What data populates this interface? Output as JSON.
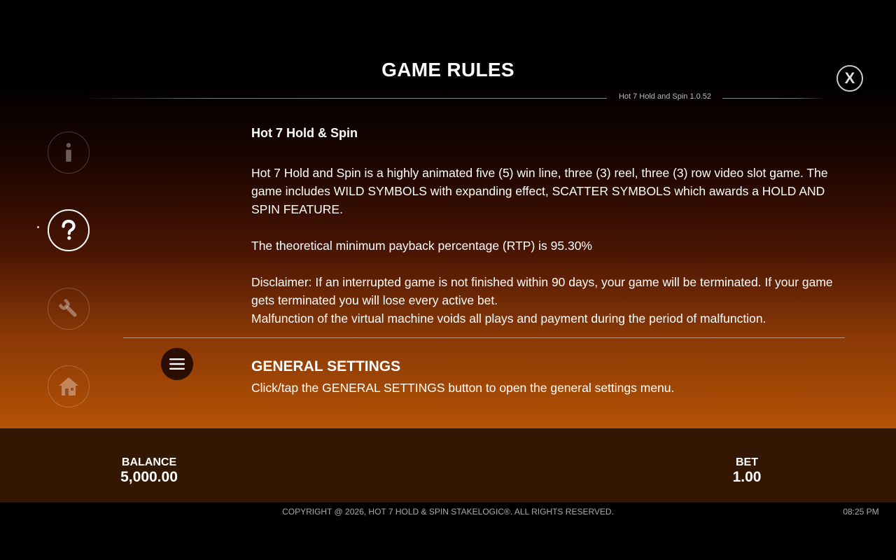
{
  "header": {
    "title": "GAME RULES",
    "version": "Hot 7 Hold and Spin 1.0.52",
    "close_label": "X"
  },
  "sidebar": {
    "items": [
      {
        "name": "info",
        "icon": "info-icon",
        "active": false
      },
      {
        "name": "rules",
        "icon": "question-icon",
        "active": true
      },
      {
        "name": "settings",
        "icon": "wrench-icon",
        "active": false
      },
      {
        "name": "home",
        "icon": "home-icon",
        "active": false
      }
    ]
  },
  "rules": {
    "game_title": "Hot 7 Hold & Spin",
    "description": "Hot 7 Hold and Spin is a highly animated five (5) win line, three (3) reel, three (3) row video slot game. The game includes WILD SYMBOLS with expanding effect, SCATTER SYMBOLS which awards a HOLD AND SPIN FEATURE.",
    "rtp": "The theoretical minimum payback percentage (RTP) is 95.30%",
    "disclaimer": "Disclaimer: If an interrupted game is not finished within 90 days, your game will be terminated. If your game gets terminated you will lose every active bet.",
    "malfunction": "Malfunction of the virtual machine voids all plays and payment during the period of malfunction."
  },
  "general_settings": {
    "icon": "menu-icon",
    "heading": "GENERAL SETTINGS",
    "text": "Click/tap the GENERAL SETTINGS button to open the general settings menu."
  },
  "bottom_bar": {
    "balance_label": "BALANCE",
    "balance_value": "5,000.00",
    "bet_label": "BET",
    "bet_value": "1.00"
  },
  "footer": {
    "copyright": "COPYRIGHT @ 2026, HOT 7 HOLD & SPIN STAKELOGIC®. ALL RIGHTS RESERVED.",
    "time": "08:25 PM"
  }
}
